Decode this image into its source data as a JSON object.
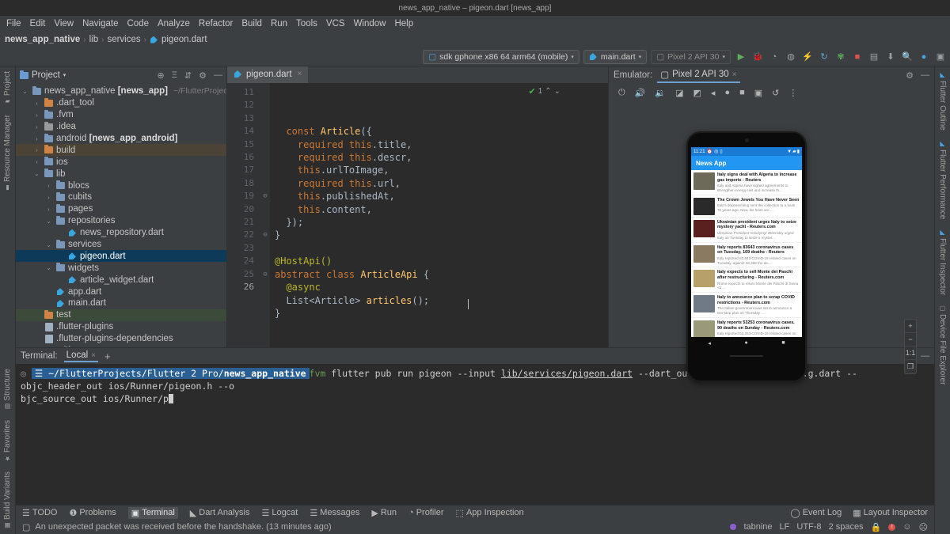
{
  "window": {
    "title": "news_app_native – pigeon.dart [news_app]"
  },
  "menu": {
    "items": [
      "File",
      "Edit",
      "View",
      "Navigate",
      "Code",
      "Analyze",
      "Refactor",
      "Build",
      "Run",
      "Tools",
      "VCS",
      "Window",
      "Help"
    ]
  },
  "breadcrumb": {
    "project": "news_app_native",
    "sep": "›",
    "parts": [
      "lib",
      "services",
      "pigeon.dart"
    ]
  },
  "toolbar": {
    "device": "sdk gphone x86 64 arm64 (mobile)",
    "config": "main.dart",
    "target": "Pixel 2 API 30",
    "caret": "▾",
    "icons": [
      "run-icon",
      "debug-icon",
      "profile-icon",
      "coverage-icon",
      "hot-reload-icon",
      "hot-restart-icon",
      "open-devtools-icon",
      "stop-icon",
      "device-manager-icon",
      "sdk-manager-icon",
      "search-icon",
      "avatar-icon",
      "layout-icon"
    ]
  },
  "left_strip": {
    "top": "Project",
    "items": [
      "Resource Manager"
    ],
    "bottom": [
      "Structure",
      "Favorites",
      "Build Variants"
    ]
  },
  "right_strip": {
    "items": [
      "Flutter Outline",
      "Flutter Performance",
      "Flutter Inspector",
      "Device File Explorer"
    ]
  },
  "project_panel": {
    "title": "Project",
    "caret": "▾",
    "header_icons": [
      "locate-icon",
      "collapse-all-icon",
      "expand-icon",
      "settings-icon",
      "hide-icon"
    ],
    "root_path": "~/FlutterProjects/F",
    "tree": [
      {
        "label": "news_app_native",
        "bold": "[news_app]",
        "depth": 0,
        "arrow": "⌄",
        "icon": "folder-module",
        "state": ""
      },
      {
        "label": ".dart_tool",
        "depth": 1,
        "arrow": "›",
        "icon": "folder-orange",
        "state": ""
      },
      {
        "label": ".fvm",
        "depth": 1,
        "arrow": "›",
        "icon": "folder-blue",
        "state": ""
      },
      {
        "label": ".idea",
        "depth": 1,
        "arrow": "›",
        "icon": "folder-idea",
        "state": ""
      },
      {
        "label": "android",
        "bold": "[news_app_android]",
        "depth": 1,
        "arrow": "›",
        "icon": "folder-module",
        "state": ""
      },
      {
        "label": "build",
        "depth": 1,
        "arrow": "›",
        "icon": "folder-orange",
        "state": "tan"
      },
      {
        "label": "ios",
        "depth": 1,
        "arrow": "›",
        "icon": "folder-module",
        "state": ""
      },
      {
        "label": "lib",
        "depth": 1,
        "arrow": "⌄",
        "icon": "folder-blue",
        "state": ""
      },
      {
        "label": "blocs",
        "depth": 2,
        "arrow": "›",
        "icon": "folder-blue",
        "state": ""
      },
      {
        "label": "cubits",
        "depth": 2,
        "arrow": "›",
        "icon": "folder-blue",
        "state": ""
      },
      {
        "label": "pages",
        "depth": 2,
        "arrow": "›",
        "icon": "folder-blue",
        "state": ""
      },
      {
        "label": "repositories",
        "depth": 2,
        "arrow": "⌄",
        "icon": "folder-blue",
        "state": ""
      },
      {
        "label": "news_repository.dart",
        "depth": 3,
        "arrow": "",
        "icon": "dart-file",
        "state": ""
      },
      {
        "label": "services",
        "depth": 2,
        "arrow": "⌄",
        "icon": "folder-blue",
        "state": ""
      },
      {
        "label": "pigeon.dart",
        "depth": 3,
        "arrow": "",
        "icon": "dart-file",
        "state": "selected"
      },
      {
        "label": "widgets",
        "depth": 2,
        "arrow": "⌄",
        "icon": "folder-blue",
        "state": ""
      },
      {
        "label": "article_widget.dart",
        "depth": 3,
        "arrow": "",
        "icon": "dart-file",
        "state": ""
      },
      {
        "label": "app.dart",
        "depth": 2,
        "arrow": "",
        "icon": "dart-file",
        "state": ""
      },
      {
        "label": "main.dart",
        "depth": 2,
        "arrow": "",
        "icon": "dart-file",
        "state": ""
      },
      {
        "label": "test",
        "depth": 1,
        "arrow": "",
        "icon": "folder-test",
        "state": "green"
      },
      {
        "label": ".flutter-plugins",
        "depth": 1,
        "arrow": "",
        "icon": "text-file",
        "state": ""
      },
      {
        "label": ".flutter-plugins-dependencies",
        "depth": 1,
        "arrow": "",
        "icon": "text-file",
        "state": ""
      },
      {
        "label": ".gitignore",
        "depth": 1,
        "arrow": "",
        "icon": "git-file",
        "state": ""
      }
    ]
  },
  "editor": {
    "tab": {
      "label": "pigeon.dart",
      "close": "×"
    },
    "inspection": {
      "count": "1",
      "check": "✔",
      "up": "⌃",
      "down": "⌄"
    },
    "first_line_number": 11,
    "lines": [
      {
        "n": 11,
        "fold": "",
        "tokens": [
          {
            "t": "  const ",
            "c": "k"
          },
          {
            "t": "Article",
            "c": "cl"
          },
          {
            "t": "({",
            "c": "pl"
          }
        ]
      },
      {
        "n": 12,
        "fold": "",
        "tokens": [
          {
            "t": "    required ",
            "c": "k"
          },
          {
            "t": "this",
            "c": "k"
          },
          {
            "t": ".title,",
            "c": "pl"
          }
        ]
      },
      {
        "n": 13,
        "fold": "",
        "tokens": [
          {
            "t": "    required ",
            "c": "k"
          },
          {
            "t": "this",
            "c": "k"
          },
          {
            "t": ".descr,",
            "c": "pl"
          }
        ]
      },
      {
        "n": 14,
        "fold": "",
        "tokens": [
          {
            "t": "    ",
            "c": "pl"
          },
          {
            "t": "this",
            "c": "k"
          },
          {
            "t": ".urlToImage,",
            "c": "pl"
          }
        ]
      },
      {
        "n": 15,
        "fold": "",
        "tokens": [
          {
            "t": "    required ",
            "c": "k"
          },
          {
            "t": "this",
            "c": "k"
          },
          {
            "t": ".url,",
            "c": "pl"
          }
        ]
      },
      {
        "n": 16,
        "fold": "",
        "tokens": [
          {
            "t": "    ",
            "c": "pl"
          },
          {
            "t": "this",
            "c": "k"
          },
          {
            "t": ".publishedAt,",
            "c": "pl"
          }
        ]
      },
      {
        "n": 17,
        "fold": "",
        "tokens": [
          {
            "t": "    ",
            "c": "pl"
          },
          {
            "t": "this",
            "c": "k"
          },
          {
            "t": ".content,",
            "c": "pl"
          }
        ]
      },
      {
        "n": 18,
        "fold": "",
        "tokens": [
          {
            "t": "  });",
            "c": "pl"
          }
        ]
      },
      {
        "n": 19,
        "fold": "⊖",
        "tokens": [
          {
            "t": "}",
            "c": "pl"
          }
        ]
      },
      {
        "n": 20,
        "fold": "",
        "tokens": []
      },
      {
        "n": 21,
        "fold": "",
        "tokens": [
          {
            "t": "@HostApi()",
            "c": "an"
          }
        ]
      },
      {
        "n": 22,
        "fold": "⊖",
        "tokens": [
          {
            "t": "abstract class ",
            "c": "k"
          },
          {
            "t": "ArticleApi",
            "c": "cl"
          },
          {
            "t": " {",
            "c": "pl"
          }
        ]
      },
      {
        "n": 23,
        "fold": "",
        "tokens": [
          {
            "t": "  @async",
            "c": "an"
          }
        ]
      },
      {
        "n": 24,
        "fold": "",
        "tokens": [
          {
            "t": "  List<Article> ",
            "c": "pl"
          },
          {
            "t": "articles",
            "c": "fn"
          },
          {
            "t": "();",
            "c": "pl"
          }
        ]
      },
      {
        "n": 25,
        "fold": "⊖",
        "tokens": [
          {
            "t": "}",
            "c": "pl"
          }
        ]
      },
      {
        "n": 26,
        "fold": "",
        "tokens": []
      }
    ]
  },
  "emulator": {
    "label": "Emulator:",
    "tab": "Pixel 2 API 30",
    "close": "×",
    "head_icons": [
      "settings-icon",
      "hide-icon"
    ],
    "toolbar_icons": [
      "power-icon",
      "volume-up-icon",
      "volume-down-icon",
      "rotate-left-icon",
      "rotate-right-icon",
      "back-icon",
      "home-icon",
      "overview-icon",
      "screenshot-icon",
      "history-icon",
      "more-icon"
    ],
    "zoom_controls": [
      "+",
      "−",
      "1:1",
      "❐"
    ],
    "phone": {
      "status_time": "11:21",
      "status_icons": [
        "alarm-icon",
        "location-icon",
        "battery-saver-icon"
      ],
      "status_right": [
        "wifi-icon",
        "signal-icon",
        "battery-icon"
      ],
      "app_title": "News App",
      "nav": [
        "◂",
        "●",
        "■"
      ],
      "articles": [
        {
          "title": "Italy signs deal with Algeria to increase gas imports - Reuters",
          "desc": "Italy and Algeria have signed agreements to strengthen energy ties and increase th...",
          "thumb": "#6d6a5a"
        },
        {
          "title": "The Crown Jewels You Have Never Seen",
          "desc": "Italy's deposed king sent the collection to a bank 75 years ago. Now, his heirs are ...",
          "thumb": "#2a2a2a"
        },
        {
          "title": "Ukrainian president urges Italy to seize mystery yacht - Reuters.com",
          "desc": "Ukrainian President Volodymyr Zelenskiy urged Italy on Tuesday to seize a myster...",
          "thumb": "#5a1f1f"
        },
        {
          "title": "Italy reports 83643 coronavirus cases on Tuesday, 169 deaths - Reuters",
          "desc": "Italy reported 83,643 COVID-19 related cases on Tuesday, against 28,368 the da...",
          "thumb": "#8a7a62"
        },
        {
          "title": "Italy expects to sell Monte dei Paschi after restructuring - Reuters.com",
          "desc": "Rome expects to return Monte dei Paschi di Siena <a ...",
          "thumb": "#b8a06a"
        },
        {
          "title": "Italy to announce plan to scrap COVID restrictions - Reuters.com",
          "desc": "The Italian government was set to announce a two-step plan on Thursday ...",
          "thumb": "#6f7a86"
        },
        {
          "title": "Italy reports 53253 coronavirus cases, 90 deaths on Sunday - Reuters.com",
          "desc": "Italy reported 53,253 COVID-19 related cases on Sunday, down from 63,992 the ...",
          "thumb": "#9a9a7a"
        }
      ]
    }
  },
  "terminal": {
    "label": "Terminal:",
    "tab": "Local",
    "close": "×",
    "plus": "+",
    "head_icons": [
      "settings-icon",
      "hide-icon"
    ],
    "prompt_icon": "◎",
    "folder_icon": "☰",
    "prompt_path_prefix": "~/FlutterProjects/Flutter 2 Pro/",
    "prompt_path_bold": "news_app_native",
    "cmd_prefix": "fvm",
    "cmd_rest": " flutter pub run pigeon --input ",
    "cmd_link1": "lib/services/pigeon.dart",
    "cmd_mid": " --dart_out lib/services/pigeon.g.dart --objc_header_out ios/Runner/pigeon.h --o",
    "cmd_line2": "bjc_source_out ios/Runner/p"
  },
  "status_tabs": {
    "items": [
      {
        "label": "TODO",
        "icon": "todo-icon",
        "active": false
      },
      {
        "label": "Problems",
        "icon": "problems-icon",
        "active": false
      },
      {
        "label": "Terminal",
        "icon": "terminal-icon",
        "active": true
      },
      {
        "label": "Dart Analysis",
        "icon": "dart-icon",
        "active": false
      },
      {
        "label": "Logcat",
        "icon": "logcat-icon",
        "active": false
      },
      {
        "label": "Messages",
        "icon": "messages-icon",
        "active": false
      },
      {
        "label": "Run",
        "icon": "run-icon",
        "active": false
      },
      {
        "label": "Profiler",
        "icon": "profiler-icon",
        "active": false
      },
      {
        "label": "App Inspection",
        "icon": "app-inspection-icon",
        "active": false
      }
    ],
    "right": [
      {
        "label": "Event Log",
        "icon": "event-log-icon"
      },
      {
        "label": "Layout Inspector",
        "icon": "layout-inspector-icon"
      }
    ]
  },
  "status_bar": {
    "message": "An unexpected packet was received before the handshake. (13 minutes ago)",
    "message_icon": "notification-icon",
    "plugin": "tabnine",
    "line_sep": "LF",
    "encoding": "UTF-8",
    "indent": "2 spaces",
    "lock_icon": "lock-icon",
    "error_count": "!",
    "faces": [
      "☺",
      "☹"
    ]
  }
}
